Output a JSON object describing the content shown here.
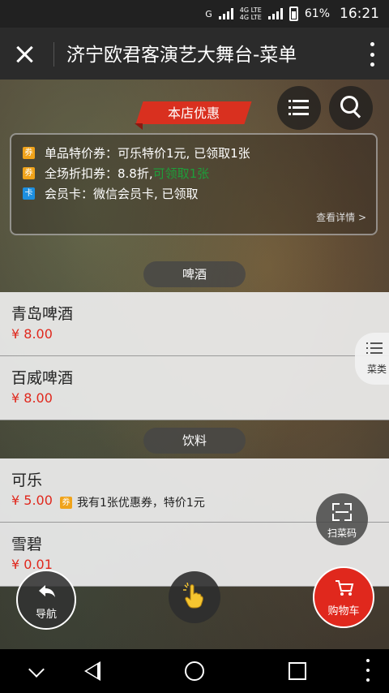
{
  "status_bar": {
    "network_left": "G",
    "network_mid_top": "4G LTE",
    "network_mid": "4G LTE",
    "battery": "61%",
    "time": "16:21"
  },
  "titlebar": {
    "title": "济宁欧君客演艺大舞台-菜单"
  },
  "promo": {
    "tag": "本店优惠",
    "rows": [
      {
        "badge": "券",
        "text": "单品特价券：可乐特价1元, 已领取1张",
        "highlight": ""
      },
      {
        "badge": "券",
        "text": "全场折扣券：8.8折, ",
        "highlight": "可领取1张"
      },
      {
        "badge": "卡",
        "text": "会员卡：微信会员卡, 已领取",
        "highlight": ""
      }
    ],
    "detail_link": "查看详情 >"
  },
  "categories": [
    {
      "name": "啤酒",
      "items": [
        {
          "name": "青岛啤酒",
          "price": "¥ 8.00"
        },
        {
          "name": "百威啤酒",
          "price": "¥ 8.00"
        }
      ]
    },
    {
      "name": "饮料",
      "items": [
        {
          "name": "可乐",
          "price": "¥ 5.00",
          "coupon_badge": "券",
          "coupon_text": "我有1张优惠券，特价1元"
        },
        {
          "name": "雪碧",
          "price": "¥ 0.01"
        }
      ]
    }
  ],
  "side_tab": {
    "label": "菜类"
  },
  "scan_button": {
    "label": "扫菜码"
  },
  "nav_button": {
    "label": "导航",
    "icon": "guide-arrow-icon"
  },
  "cart_button": {
    "label": "购物车",
    "icon": "cart-icon"
  },
  "colors": {
    "accent_red": "#e0281d",
    "ribbon_red": "#d9301f",
    "coupon_orange": "#f0a31a",
    "card_blue": "#1d8fe0",
    "highlight_green": "#1e9e3a"
  }
}
